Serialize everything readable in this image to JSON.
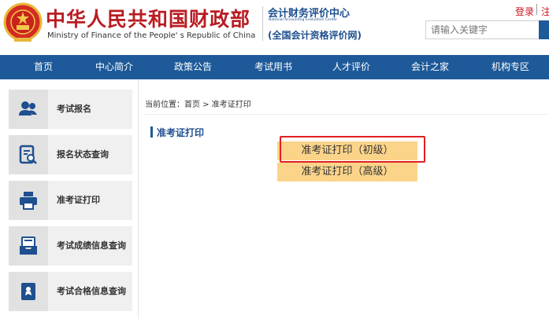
{
  "header": {
    "title_cn": "中华人民共和国财政部",
    "title_en": "Ministry of Finance of the People' s Republic of China",
    "center_name": "会计财务评价中心",
    "center_name_en": "National Accounting Evaluation Center",
    "site_name": "(全国会计资格评价网)",
    "login": "登录",
    "register": "注",
    "search_placeholder": "请输入关键字",
    "brand_color": "#b81c22",
    "nav_color": "#1e5a99"
  },
  "nav": {
    "items": [
      "首页",
      "中心简介",
      "政策公告",
      "考试用书",
      "人才评价",
      "会计之家",
      "机构专区"
    ]
  },
  "sidebar": {
    "items": [
      {
        "label": "考试报名",
        "icon": "users-icon"
      },
      {
        "label": "报名状态查询",
        "icon": "document-search-icon"
      },
      {
        "label": "准考证打印",
        "icon": "printer-icon"
      },
      {
        "label": "考试成绩信息查询",
        "icon": "inbox-icon"
      },
      {
        "label": "考试合格信息查询",
        "icon": "certificate-icon"
      }
    ]
  },
  "breadcrumb": {
    "text": "当前位置：首页 > 准考证打印"
  },
  "main": {
    "section_title": "准考证打印",
    "buttons": [
      "准考证打印（初级）",
      "准考证打印（高级）"
    ],
    "button_color": "#fbd48a",
    "highlight_color": "#e02020"
  }
}
